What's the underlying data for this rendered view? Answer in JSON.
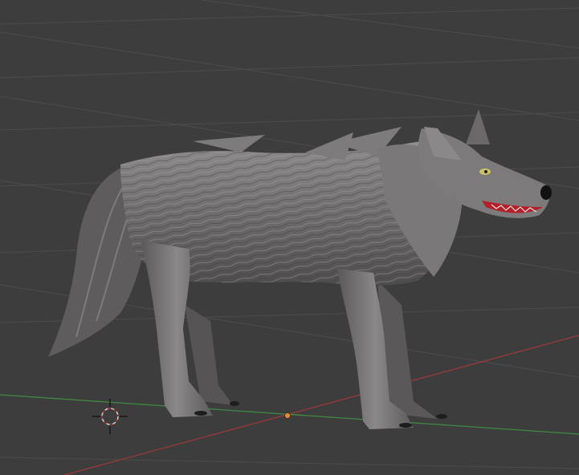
{
  "viewport": {
    "background_color": "#3d3d3d",
    "grid_color": "#4c4c4c",
    "x_axis_color": "#9a3a3a",
    "y_axis_color": "#3f8a3f",
    "origin_color": "#e08a3a"
  },
  "scene": {
    "model": "wolf",
    "fur_color": "#6f6e6f",
    "fur_highlight": "#9a999a",
    "fur_shadow": "#4a4849",
    "mouth_color": "#b3202a",
    "eye_color": "#c9c06a"
  },
  "cursor_icon": "3d-cursor-icon",
  "origin_icon": "object-origin-icon"
}
